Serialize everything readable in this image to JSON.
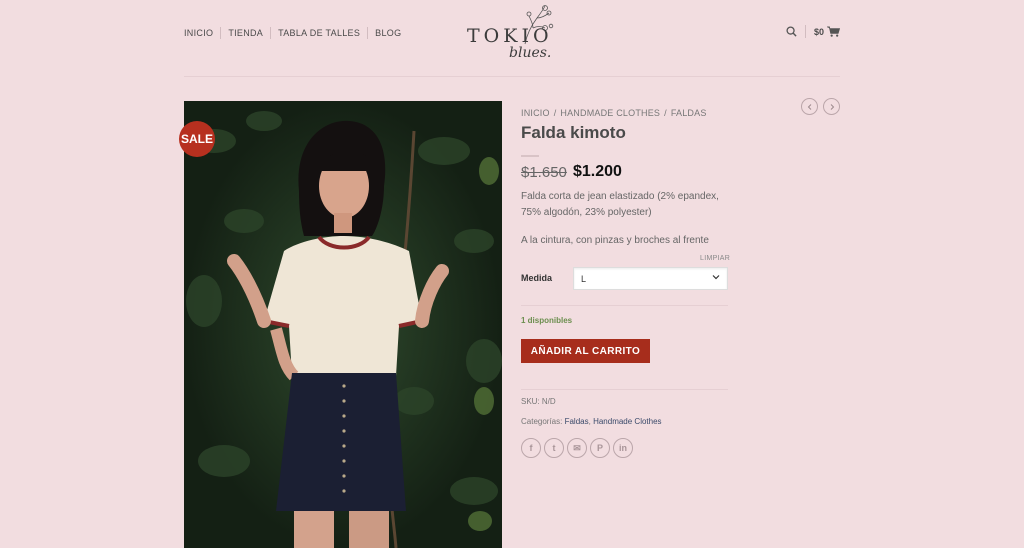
{
  "nav": {
    "items": [
      {
        "label": "INICIO"
      },
      {
        "label": "TIENDA"
      },
      {
        "label": "TABLA DE TALLES"
      },
      {
        "label": "BLOG"
      }
    ]
  },
  "logo": {
    "line1": "TOKIO",
    "line2": "blues."
  },
  "header": {
    "cart_total": "$0",
    "search_icon": "search-icon",
    "cart_icon": "cart-icon"
  },
  "product": {
    "sale_badge": "SALE",
    "breadcrumb": [
      "INICIO",
      "HANDMADE CLOTHES",
      "FALDAS"
    ],
    "breadcrumb_sep": "/",
    "title": "Falda kimoto",
    "old_price": "$1.650",
    "new_price": "$1.200",
    "description": "Falda corta de jean elastizado (2% epandex, 75% algodón, 23% polyester)",
    "description2": "A la cintura, con pinzas y broches al frente",
    "clear_label": "LIMPIAR",
    "variation_label": "Medida",
    "variation_value": "L",
    "stock": "1 disponibles",
    "add_to_cart": "AÑADIR AL CARRITO",
    "sku_label": "SKU:",
    "sku_value": "N/D",
    "categories_label": "Categorías:",
    "categories": [
      "Faldas",
      "Handmade Clothes"
    ]
  },
  "share": [
    {
      "icon": "facebook-icon",
      "glyph": "f"
    },
    {
      "icon": "twitter-icon",
      "glyph": "t"
    },
    {
      "icon": "email-icon",
      "glyph": "✉"
    },
    {
      "icon": "pinterest-icon",
      "glyph": "P"
    },
    {
      "icon": "linkedin-icon",
      "glyph": "in"
    }
  ],
  "colors": {
    "accent": "#a72d1c",
    "sale": "#b7301f",
    "background": "#f2dde0",
    "stock": "#6b8e4e"
  }
}
